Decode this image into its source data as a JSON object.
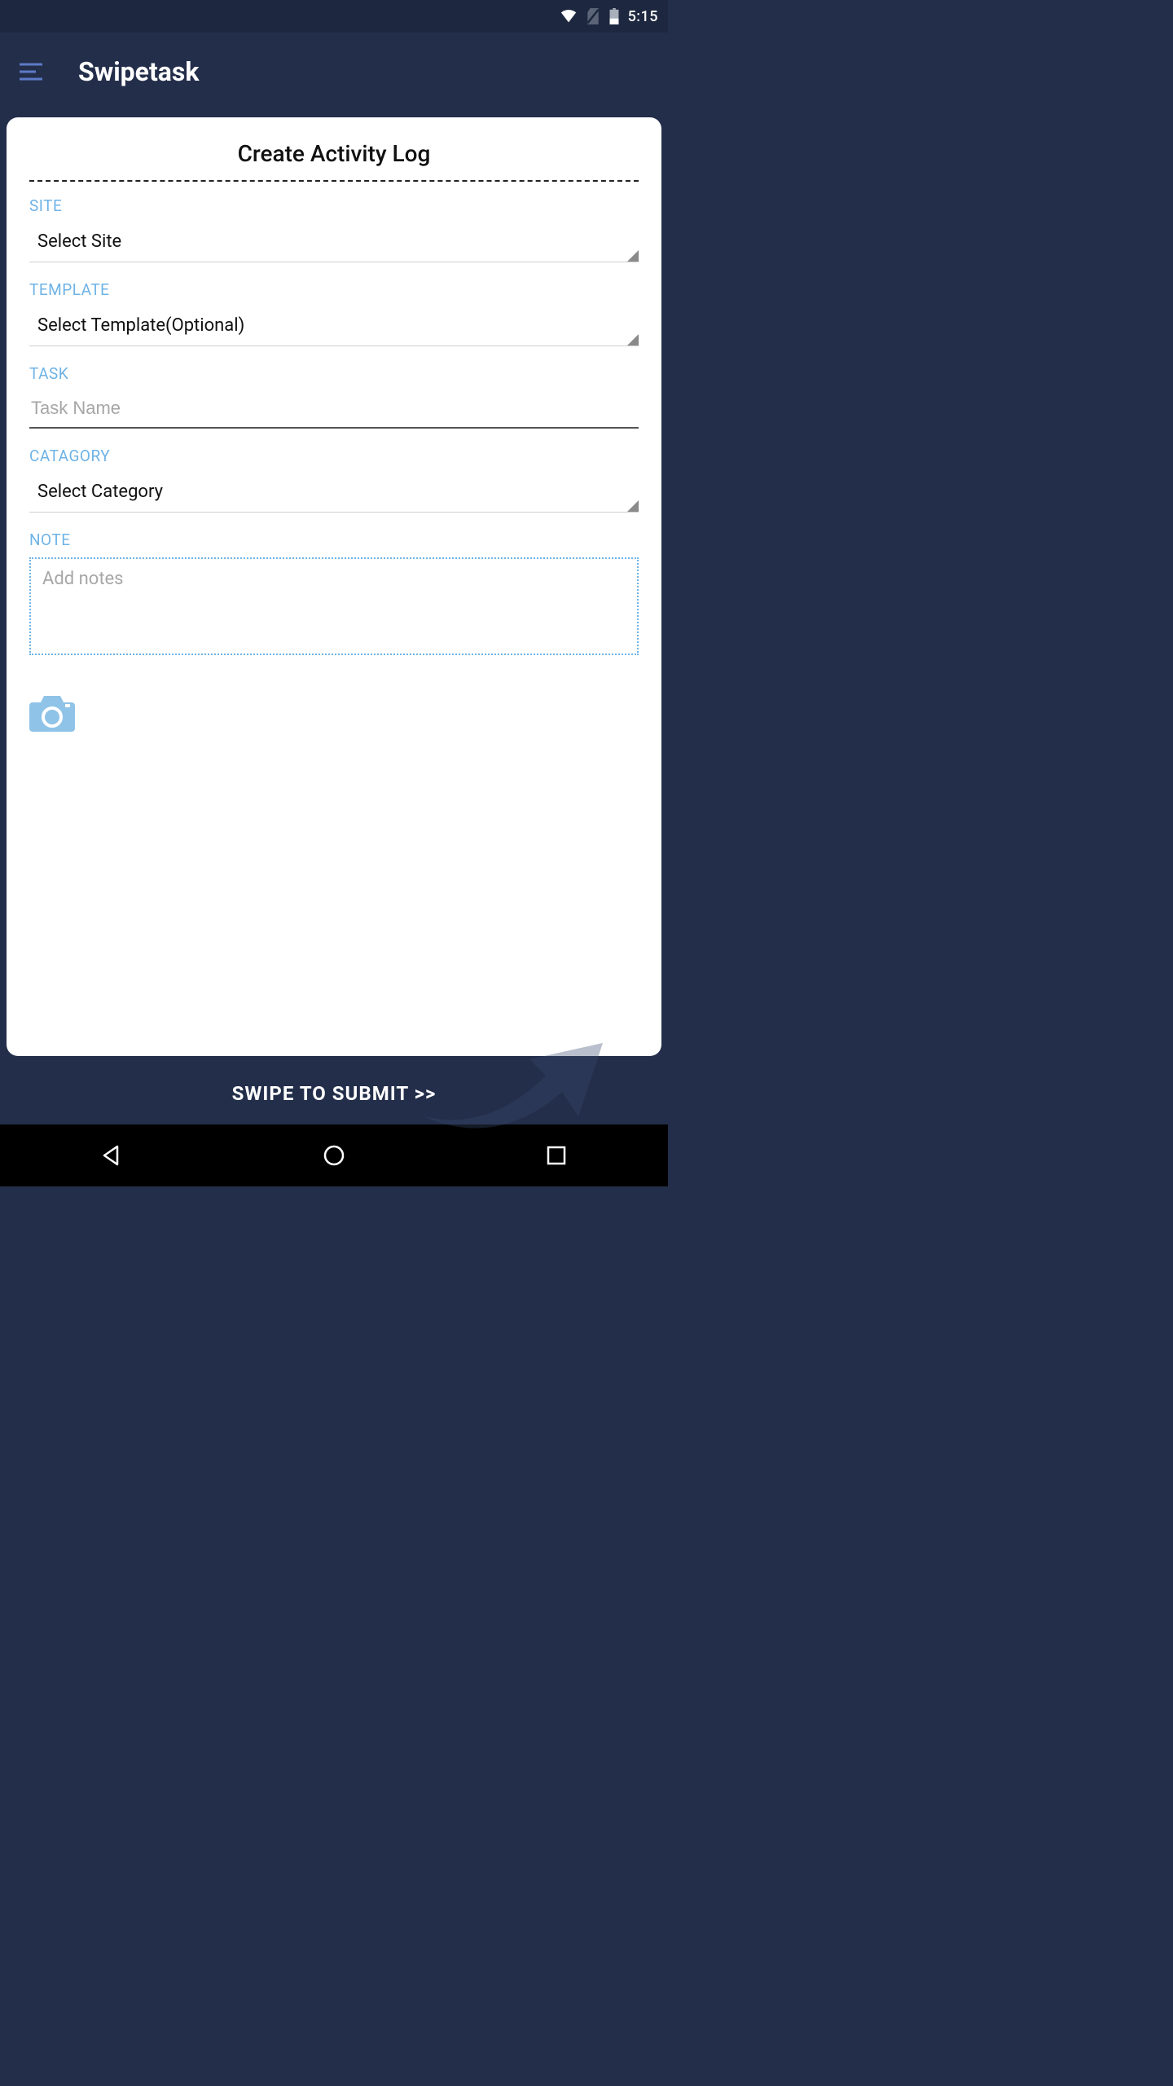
{
  "status": {
    "time": "5:15"
  },
  "header": {
    "title": "Swipetask"
  },
  "card": {
    "title": "Create Activity Log",
    "site": {
      "label": "SITE",
      "value": "Select Site"
    },
    "template": {
      "label": "TEMPLATE",
      "value": "Select Template(Optional)"
    },
    "task": {
      "label": "TASK",
      "placeholder": "Task Name"
    },
    "category": {
      "label": "CATAGORY",
      "value": "Select Category"
    },
    "note": {
      "label": "NOTE",
      "placeholder": "Add notes"
    }
  },
  "submit": {
    "label": "SWIPE TO SUBMIT >>"
  }
}
